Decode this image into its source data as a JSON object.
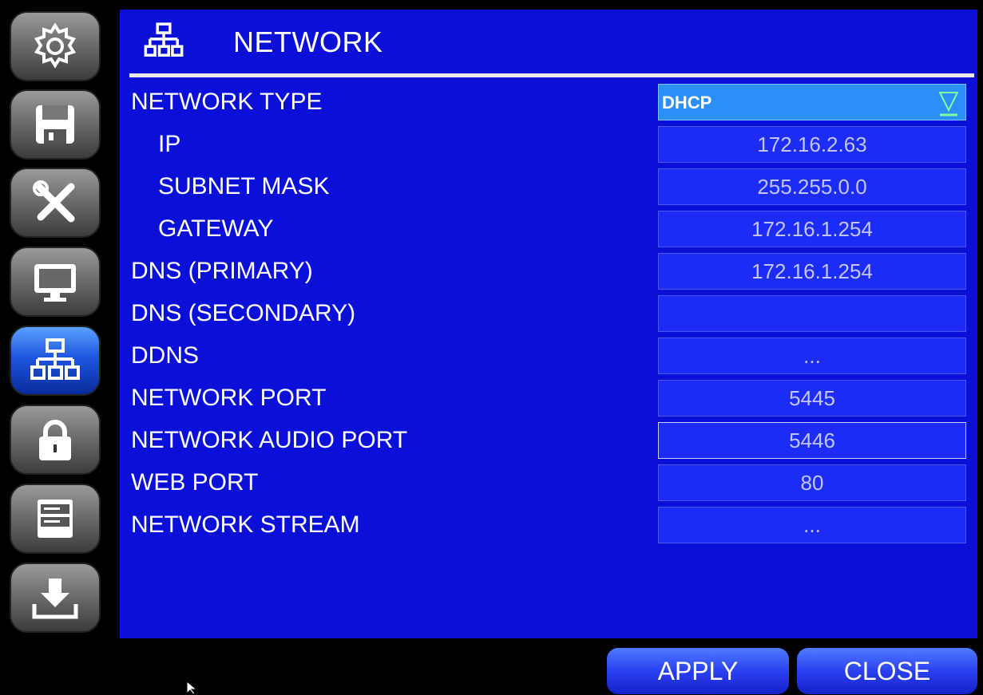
{
  "header": {
    "title": "NETWORK",
    "icon": "network-icon"
  },
  "sidebar": {
    "items": [
      {
        "name": "settings",
        "icon": "gear-icon"
      },
      {
        "name": "storage",
        "icon": "floppy-disk-icon"
      },
      {
        "name": "tools",
        "icon": "tools-icon"
      },
      {
        "name": "display",
        "icon": "monitor-icon"
      },
      {
        "name": "network",
        "icon": "network-icon",
        "active": true
      },
      {
        "name": "security",
        "icon": "lock-icon"
      },
      {
        "name": "devices",
        "icon": "storage-drives-icon"
      },
      {
        "name": "download",
        "icon": "download-icon"
      }
    ]
  },
  "form": {
    "network_type": {
      "label": "NETWORK TYPE",
      "value": "DHCP"
    },
    "ip": {
      "label": "IP",
      "value": "172.16.2.63"
    },
    "subnet_mask": {
      "label": "SUBNET MASK",
      "value": "255.255.0.0"
    },
    "gateway": {
      "label": "GATEWAY",
      "value": "172.16.1.254"
    },
    "dns_primary": {
      "label": "DNS (PRIMARY)",
      "value": "172.16.1.254"
    },
    "dns_secondary": {
      "label": "DNS (SECONDARY)",
      "value": ""
    },
    "ddns": {
      "label": "DDNS",
      "value": "..."
    },
    "network_port": {
      "label": "NETWORK PORT",
      "value": "5445"
    },
    "network_audio_port": {
      "label": "NETWORK AUDIO PORT",
      "value": "5446"
    },
    "web_port": {
      "label": "WEB PORT",
      "value": "80"
    },
    "network_stream": {
      "label": "NETWORK STREAM",
      "value": "..."
    }
  },
  "footer": {
    "apply_label": "APPLY",
    "close_label": "CLOSE"
  },
  "colors": {
    "panel": "#0a10d8",
    "field": "#1d2cf4",
    "select": "#2c8ef8",
    "button": "#2a40f0"
  }
}
